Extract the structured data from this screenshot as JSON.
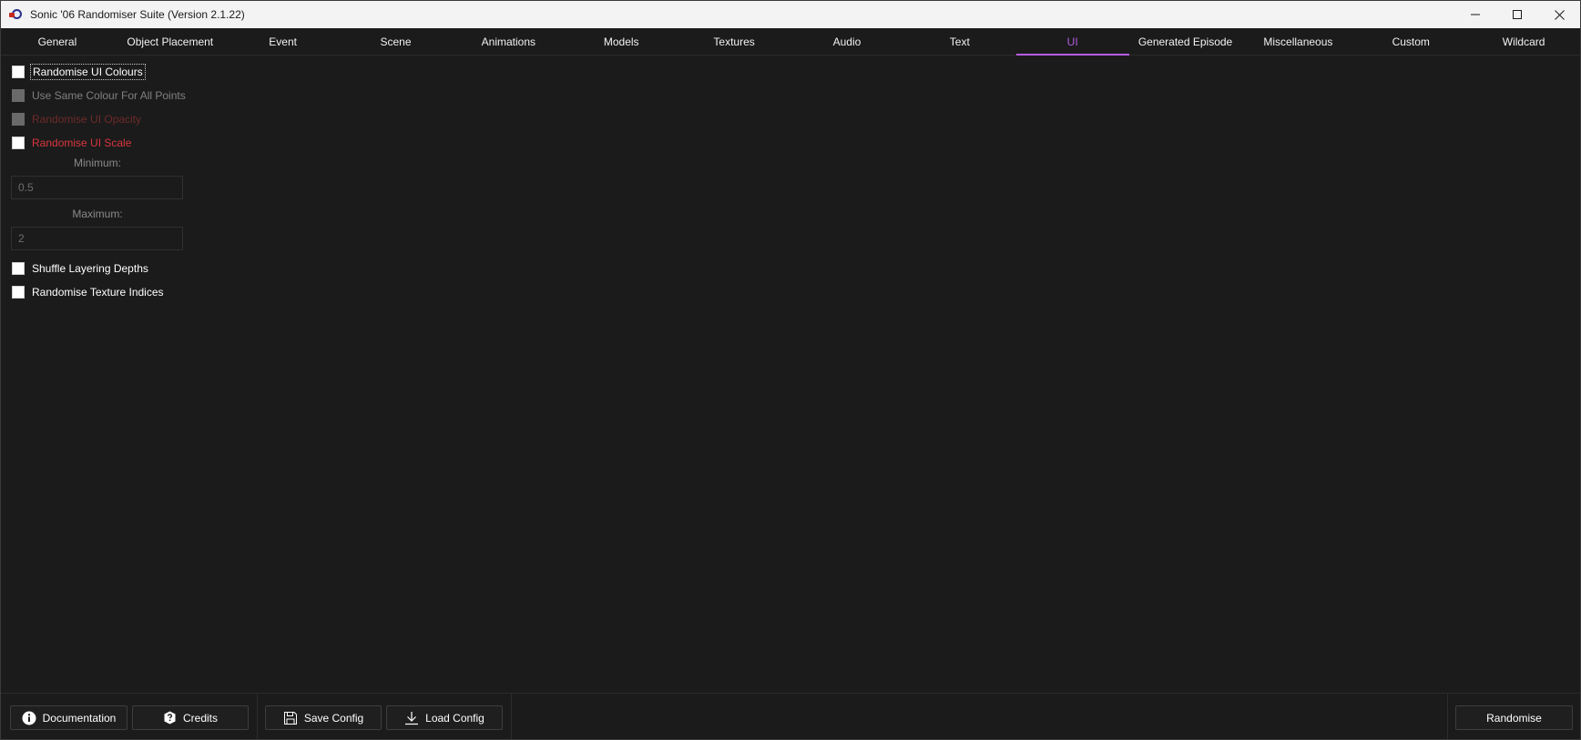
{
  "window": {
    "title": "Sonic '06 Randomiser Suite (Version 2.1.22)"
  },
  "tabs": [
    {
      "label": "General"
    },
    {
      "label": "Object Placement"
    },
    {
      "label": "Event"
    },
    {
      "label": "Scene"
    },
    {
      "label": "Animations"
    },
    {
      "label": "Models"
    },
    {
      "label": "Textures"
    },
    {
      "label": "Audio"
    },
    {
      "label": "Text"
    },
    {
      "label": "UI",
      "active": true
    },
    {
      "label": "Generated Episode"
    },
    {
      "label": "Miscellaneous"
    },
    {
      "label": "Custom"
    },
    {
      "label": "Wildcard"
    }
  ],
  "ui_tab": {
    "randomise_colours": {
      "label": "Randomise UI Colours",
      "checked": false
    },
    "same_colour": {
      "label": "Use Same Colour For All Points",
      "checked": false,
      "enabled": false
    },
    "randomise_opacity": {
      "label": "Randomise UI Opacity",
      "checked": false,
      "enabled": false
    },
    "randomise_scale": {
      "label": "Randomise UI Scale",
      "checked": false
    },
    "minimum": {
      "label": "Minimum:",
      "value": "0.5"
    },
    "maximum": {
      "label": "Maximum:",
      "value": "2"
    },
    "shuffle_layering": {
      "label": "Shuffle Layering Depths",
      "checked": false
    },
    "randomise_texture_indices": {
      "label": "Randomise Texture Indices",
      "checked": false
    }
  },
  "bottom": {
    "documentation": "Documentation",
    "credits": "Credits",
    "save_config": "Save Config",
    "load_config": "Load Config",
    "randomise": "Randomise"
  },
  "colors": {
    "accent": "#b45de3",
    "background": "#1b1b1b",
    "warning_red": "#d9363e"
  }
}
